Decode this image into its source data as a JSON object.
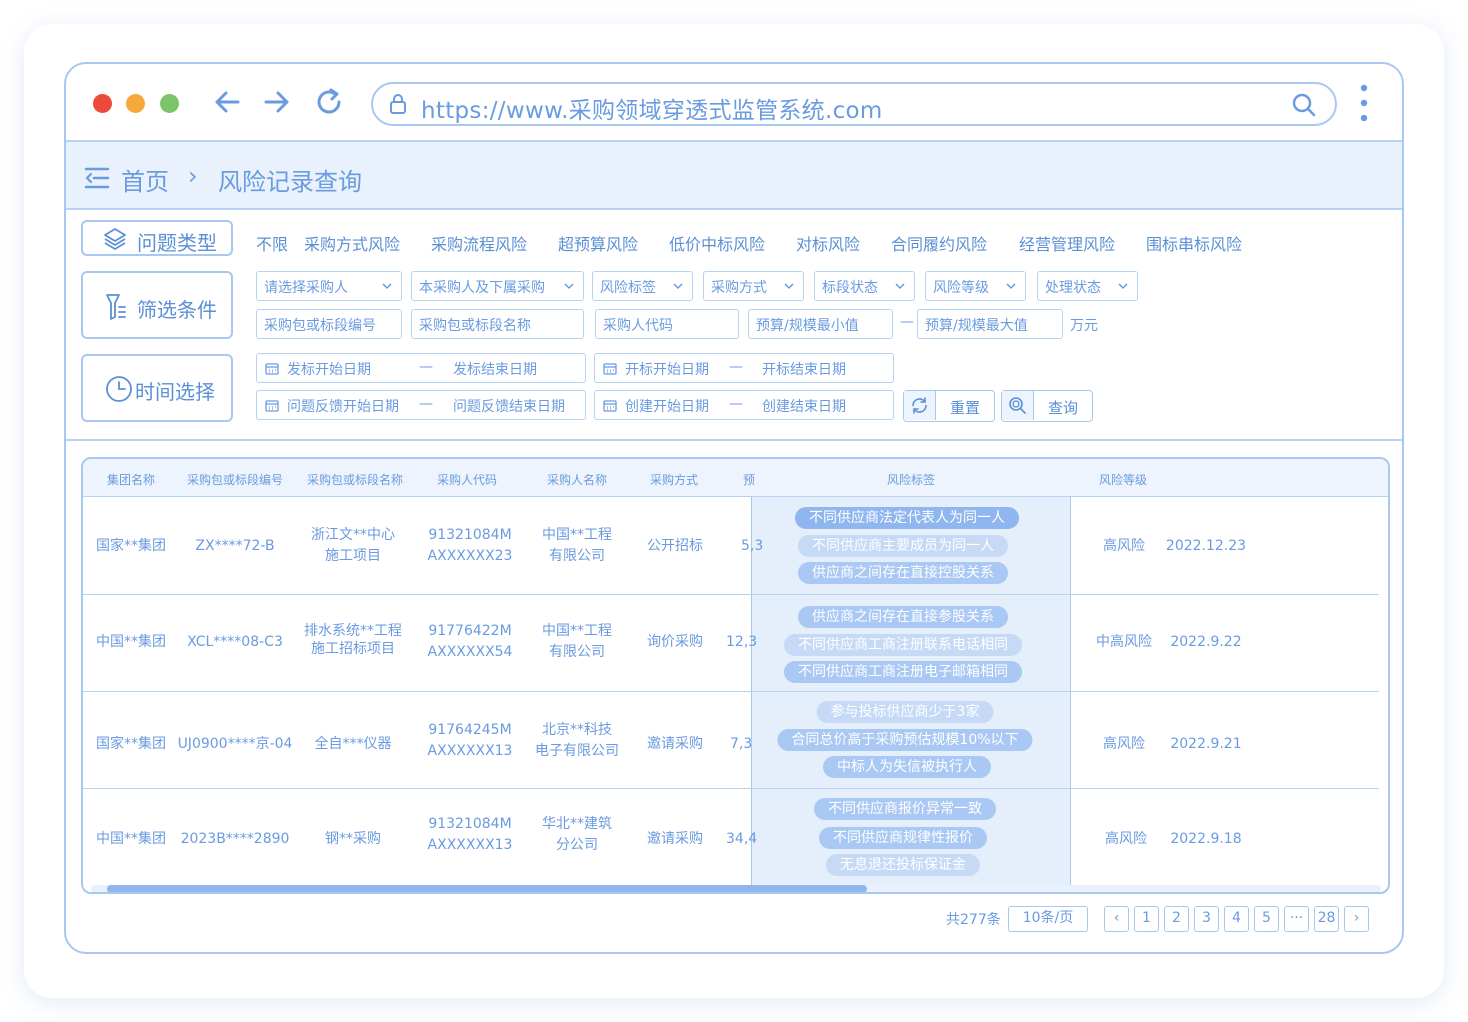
{
  "browser": {
    "url": "https://www.采购领域穿透式监管系统.com"
  },
  "breadcrumb": {
    "home": "首页",
    "separator": "›",
    "current": "风险记录查询"
  },
  "side_buttons": {
    "issue_type": "问题类型",
    "filter": "筛选条件",
    "time": "时间选择"
  },
  "risk_types": [
    "不限",
    "采购方式风险",
    "采购流程风险",
    "超预算风险",
    "低价中标风险",
    "对标风险",
    "合同履约风险",
    "经营管理风险",
    "围标串标风险"
  ],
  "dropdowns": [
    "请选择采购人",
    "本采购人及下属采购",
    "风险标签",
    "采购方式",
    "标段状态",
    "风险等级",
    "处理状态"
  ],
  "inputs": {
    "package_no": "采购包或标段编号",
    "package_name": "采购包或标段名称",
    "buyer_code": "采购人代码",
    "budget_min": "预算/规模最小值",
    "range_dash": "—",
    "budget_max": "预算/规模最大值",
    "unit": "万元"
  },
  "dates": {
    "dash": "—",
    "bid_start": "发标开始日期",
    "bid_end": "发标结束日期",
    "open_start": "开标开始日期",
    "open_end": "开标结束日期",
    "feedback_start": "问题反馈开始日期",
    "feedback_end": "问题反馈结束日期",
    "create_start": "创建开始日期",
    "create_end": "创建结束日期"
  },
  "actions": {
    "reset": "重置",
    "query": "查询"
  },
  "table": {
    "headers": [
      "集团名称",
      "采购包或标段编号",
      "采购包或标段名称",
      "采购人代码",
      "采购人名称",
      "采购方式",
      "预",
      "风险标签",
      "风险等级"
    ],
    "rows": [
      {
        "group": "国家**集团",
        "pkg_no": "ZX****72-B",
        "pkg_name_1": "浙江文**中心",
        "pkg_name_2": "施工项目",
        "code_1": "91321084M",
        "code_2": "AXXXXXX23",
        "buyer_1": "中国**工程",
        "buyer_2": "有限公司",
        "method": "公开招标",
        "budget": "5,3",
        "tags": [
          "不同供应商法定代表人为同一人",
          "不同供应商主要成员为同一人",
          "供应商之间存在直接控股关系"
        ],
        "level": "高风险",
        "date": "2022.12.23"
      },
      {
        "group": "中国**集团",
        "pkg_no": "XCL****08-C3",
        "pkg_name_1": "排水系统**工程",
        "pkg_name_2": "施工招标项目",
        "code_1": "91776422M",
        "code_2": "AXXXXXX54",
        "buyer_1": "中国**工程",
        "buyer_2": "有限公司",
        "method": "询价采购",
        "budget": "12,3",
        "tags": [
          "供应商之间存在直接参股关系",
          "不同供应商工商注册联系电话相同",
          "不同供应商工商注册电子邮箱相同"
        ],
        "level": "中高风险",
        "date": "2022.9.22"
      },
      {
        "group": "国家**集团",
        "pkg_no": "UJ0900****京-04",
        "pkg_name_1": "全自***仪器",
        "pkg_name_2": "",
        "code_1": "91764245M",
        "code_2": "AXXXXXX13",
        "buyer_1": "北京**科技",
        "buyer_2": "电子有限公司",
        "method": "邀请采购",
        "budget": "7,3",
        "tags": [
          "参与投标供应商少于3家",
          "合同总价高于采购预估规模10%以下",
          "中标人为失信被执行人"
        ],
        "level": "高风险",
        "date": "2022.9.21"
      },
      {
        "group": "中国**集团",
        "pkg_no": "2023B****2890",
        "pkg_name_1": "钢**采购",
        "pkg_name_2": "",
        "code_1": "91321084M",
        "code_2": "AXXXXXX13",
        "buyer_1": "华北**建筑",
        "buyer_2": "分公司",
        "method": "邀请采购",
        "budget": "34,4",
        "tags": [
          "不同供应商报价异常一致",
          "不同供应商规律性报价",
          "无息退还投标保证金"
        ],
        "level": "高风险",
        "date": "2022.9.18"
      }
    ]
  },
  "pagination": {
    "total": "共277条",
    "page_size": "10条/页",
    "pages": [
      "1",
      "2",
      "3",
      "4",
      "5",
      "···",
      "28"
    ],
    "prev": "‹",
    "next": "›"
  }
}
